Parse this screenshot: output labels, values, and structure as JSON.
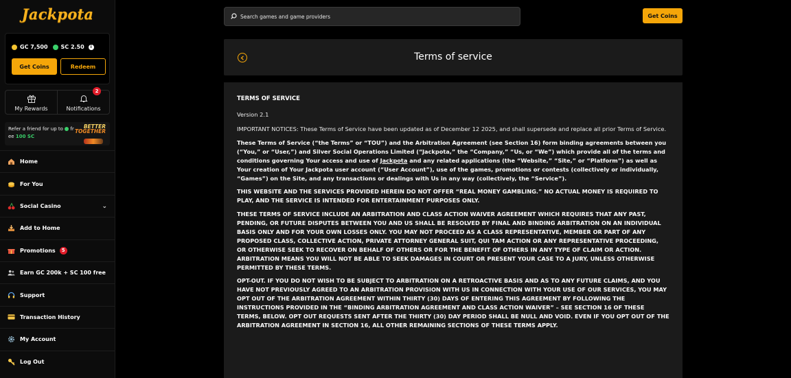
{
  "brand": {
    "logo": "Jackpota"
  },
  "wallet": {
    "gc": "GC 7,500",
    "sc": "SC 2.50",
    "info_icon": "i",
    "get_coins": "Get Coins",
    "redeem": "Redeem"
  },
  "quick": {
    "rewards": "My Rewards",
    "notifications": "Notifications",
    "notification_count": "2"
  },
  "refer": {
    "text": "Refer a friend for up to",
    "free": "free",
    "amount": "100 SC",
    "brand_line1": "BETTER",
    "brand_line2": "TOGETHER"
  },
  "nav": {
    "items": [
      {
        "label": "Home",
        "icon": "home-icon"
      },
      {
        "label": "For You",
        "icon": "coin-stack-icon"
      },
      {
        "label": "Social Casino",
        "icon": "cherry-icon"
      },
      {
        "label": "Add to Home",
        "icon": "download-icon"
      },
      {
        "label": "Promotions",
        "icon": "gift-icon",
        "badge": "5"
      },
      {
        "label": "Earn GC 200k + SC 100 free",
        "icon": "users-icon"
      },
      {
        "label": "Support",
        "icon": "headset-icon"
      },
      {
        "label": "Transaction History",
        "icon": "card-icon"
      },
      {
        "label": "My Account",
        "icon": "gear-icon"
      },
      {
        "label": "Log Out",
        "icon": "key-icon"
      }
    ]
  },
  "search": {
    "placeholder": "Search games and game providers"
  },
  "topbar": {
    "get_coins": "Get Coins"
  },
  "page": {
    "title": "Terms of service"
  },
  "doc": {
    "heading": "TERMS OF SERVICE",
    "version": "Version 2.1",
    "notice": "IMPORTANT NOTICES: These Terms of Service have been updated as of December 12 2025, and shall supersede and replace all prior Terms of Service.",
    "p1_a": "These Terms of Service (“the Terms” or “TOU”) and the Arbitration Agreement (see Section 16) form binding agreements between you (“You,” or “User,”) and Silver Social Operations Limited (“Jackpota,” the “Company,” “Us, or “We”) which provide all of the terms and conditions governing Your access and use of ",
    "p1_link": "Jackpota",
    "p1_b": " and any related applications (the “Website,” “Site,” or “Platform”) as well as Your creation of Your Jackpota user account (“User Account”), use of the games, promotions or contests (collectively or individually, “Games”) on the Site, and any transactions or dealings with Us in any way (collectively, the “Service”).",
    "p2": "THIS WEBSITE AND THE SERVICES PROVIDED HEREIN DO NOT OFFER “REAL MONEY GAMBLING.” NO ACTUAL MONEY IS REQUIRED TO PLAY, AND THE SERVICE IS INTENDED FOR ENTERTAINMENT PURPOSES ONLY.",
    "p3": "THESE TERMS OF SERVICE INCLUDE AN ARBITRATION AND CLASS ACTION WAIVER AGREEMENT WHICH REQUIRES THAT ANY PAST, PENDING, OR FUTURE DISPUTES BETWEEN YOU AND US SHALL BE RESOLVED BY FINAL AND BINDING ARBITRATION ON AN INDIVIDUAL BASIS ONLY AND FOR YOUR OWN LOSSES ONLY. YOU MAY NOT PROCEED AS A CLASS REPRESENTATIVE, MEMBER OR PART OF ANY PROPOSED CLASS, COLLECTIVE ACTION, PRIVATE ATTORNEY GENERAL SUIT, QUI TAM ACTION OR ANY REPRESENTATIVE PROCEEDING, OR OTHERWISE SEEK TO RECOVER ON BEHALF OF OTHERS OR FOR THE BENEFIT OF OTHERS IN ANY TYPE OF CLAIM OR ACTION. ARBITRATION MEANS YOU WILL NOT BE ABLE TO SEEK DAMAGES IN COURT OR PRESENT YOUR CASE TO A JURY, UNLESS OTHERWISE PERMITTED BY THESE TERMS.",
    "p4": "OPT-OUT. IF YOU DO NOT WISH TO BE SUBJECT TO ARBITRATION ON A RETROACTIVE BASIS AND AS TO ANY FUTURE CLAIMS, AND YOU HAVE NOT PREVIOUSLY AGREED TO AN ARBITRATION PROVISION WITH US IN CONNECTION WITH YOUR USE OF OUR SERVICES, YOU MAY OPT OUT OF THE ARBITRATION AGREEMENT WITHIN THIRTY (30) DAYS OF ENTERING THIS AGREEMENT BY FOLLOWING THE INSTRUCTIONS PROVIDED IN THE “BINDING ARBITRATION AGREEMENT AND CLASS ACTION WAIVER” – SEE SECTION 16 OF THESE TERMS, BELOW. OPT OUT REQUESTS SENT AFTER THE THIRTY (30) DAY PERIOD SHALL BE NULL AND VOID. EVEN IF YOU OPT OUT OF THE ARBITRATION AGREEMENT IN SECTION 16, ALL OTHER REMAINING SECTIONS OF THESE TERMS APPLY."
  },
  "colors": {
    "accent": "#f5a609",
    "badge": "#e11d2a",
    "sc_green": "#3ad06a"
  }
}
